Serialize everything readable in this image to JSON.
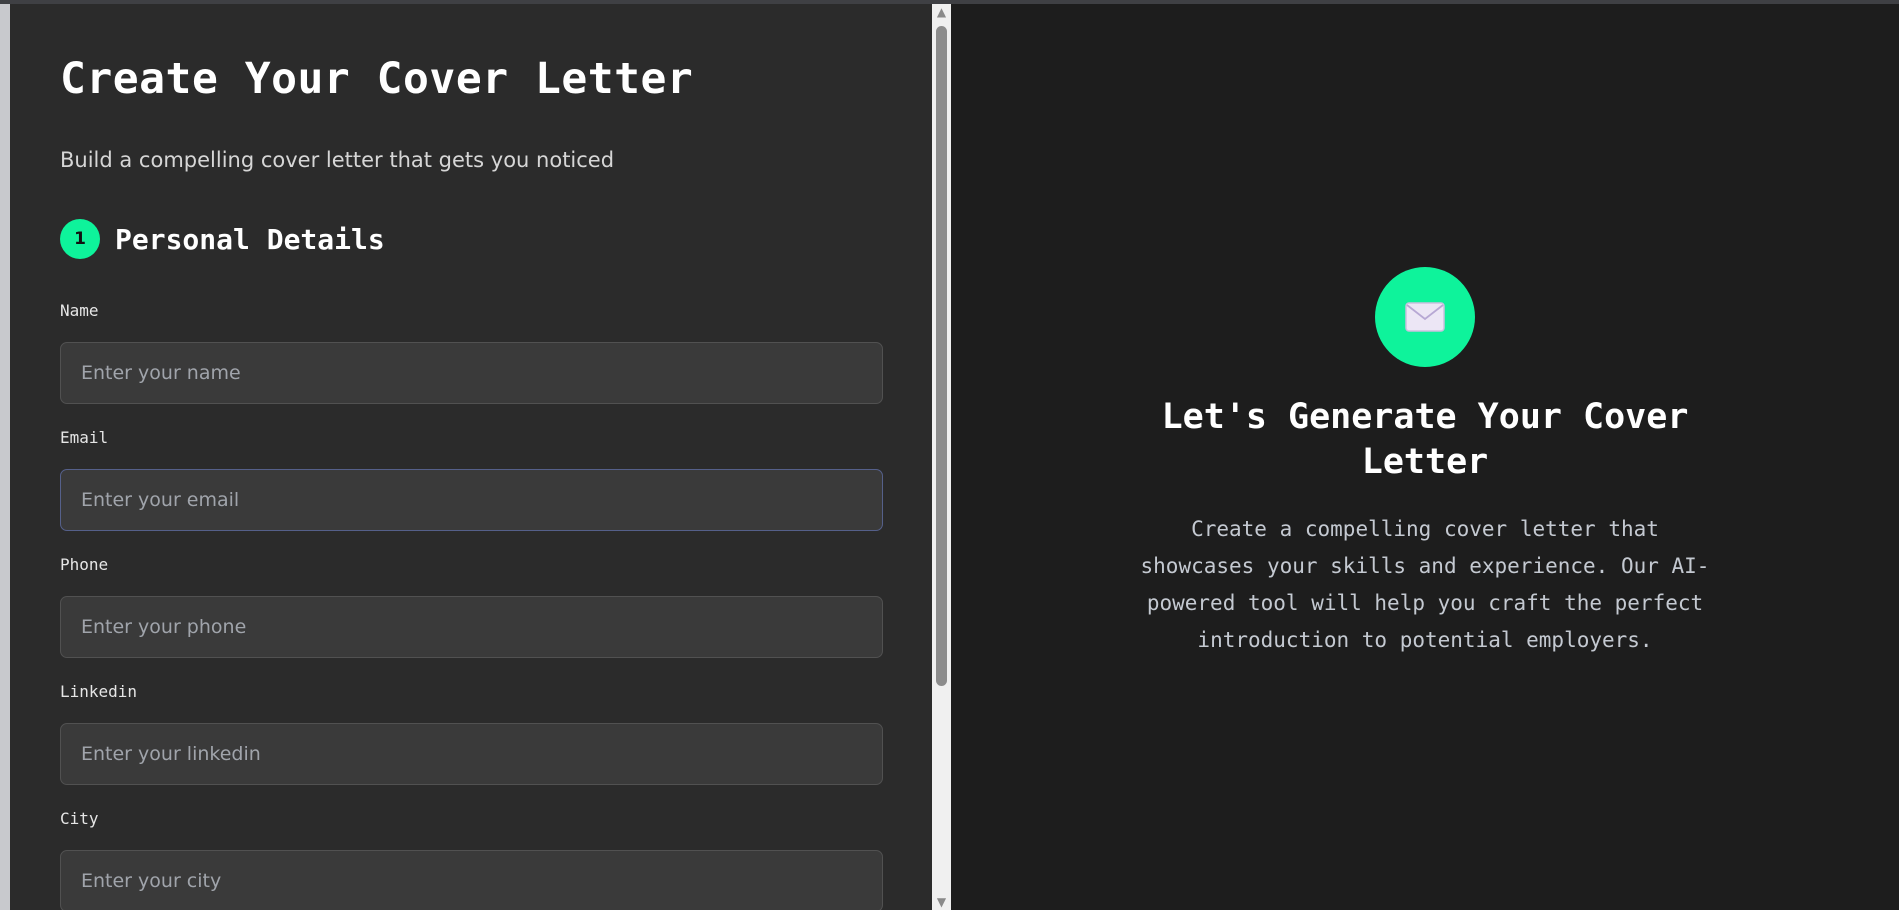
{
  "form": {
    "title": "Create Your Cover Letter",
    "subtitle": "Build a compelling cover letter that gets you noticed",
    "section": {
      "step": "1",
      "title": "Personal Details"
    },
    "fields": [
      {
        "label": "Name",
        "placeholder": "Enter your name",
        "value": ""
      },
      {
        "label": "Email",
        "placeholder": "Enter your email",
        "value": ""
      },
      {
        "label": "Phone",
        "placeholder": "Enter your phone",
        "value": ""
      },
      {
        "label": "Linkedin",
        "placeholder": "Enter your linkedin",
        "value": ""
      },
      {
        "label": "City",
        "placeholder": "Enter your city",
        "value": ""
      }
    ]
  },
  "preview": {
    "icon": "envelope-icon",
    "title": "Let's Generate Your Cover Letter",
    "description": "Create a compelling cover letter that showcases your skills and experience. Our AI-powered tool will help you craft the perfect introduction to potential employers."
  },
  "colors": {
    "accent": "#0ef39b",
    "form_background": "#2b2b2b",
    "preview_background": "#1d1d1d",
    "input_background": "#3a3a3a"
  }
}
